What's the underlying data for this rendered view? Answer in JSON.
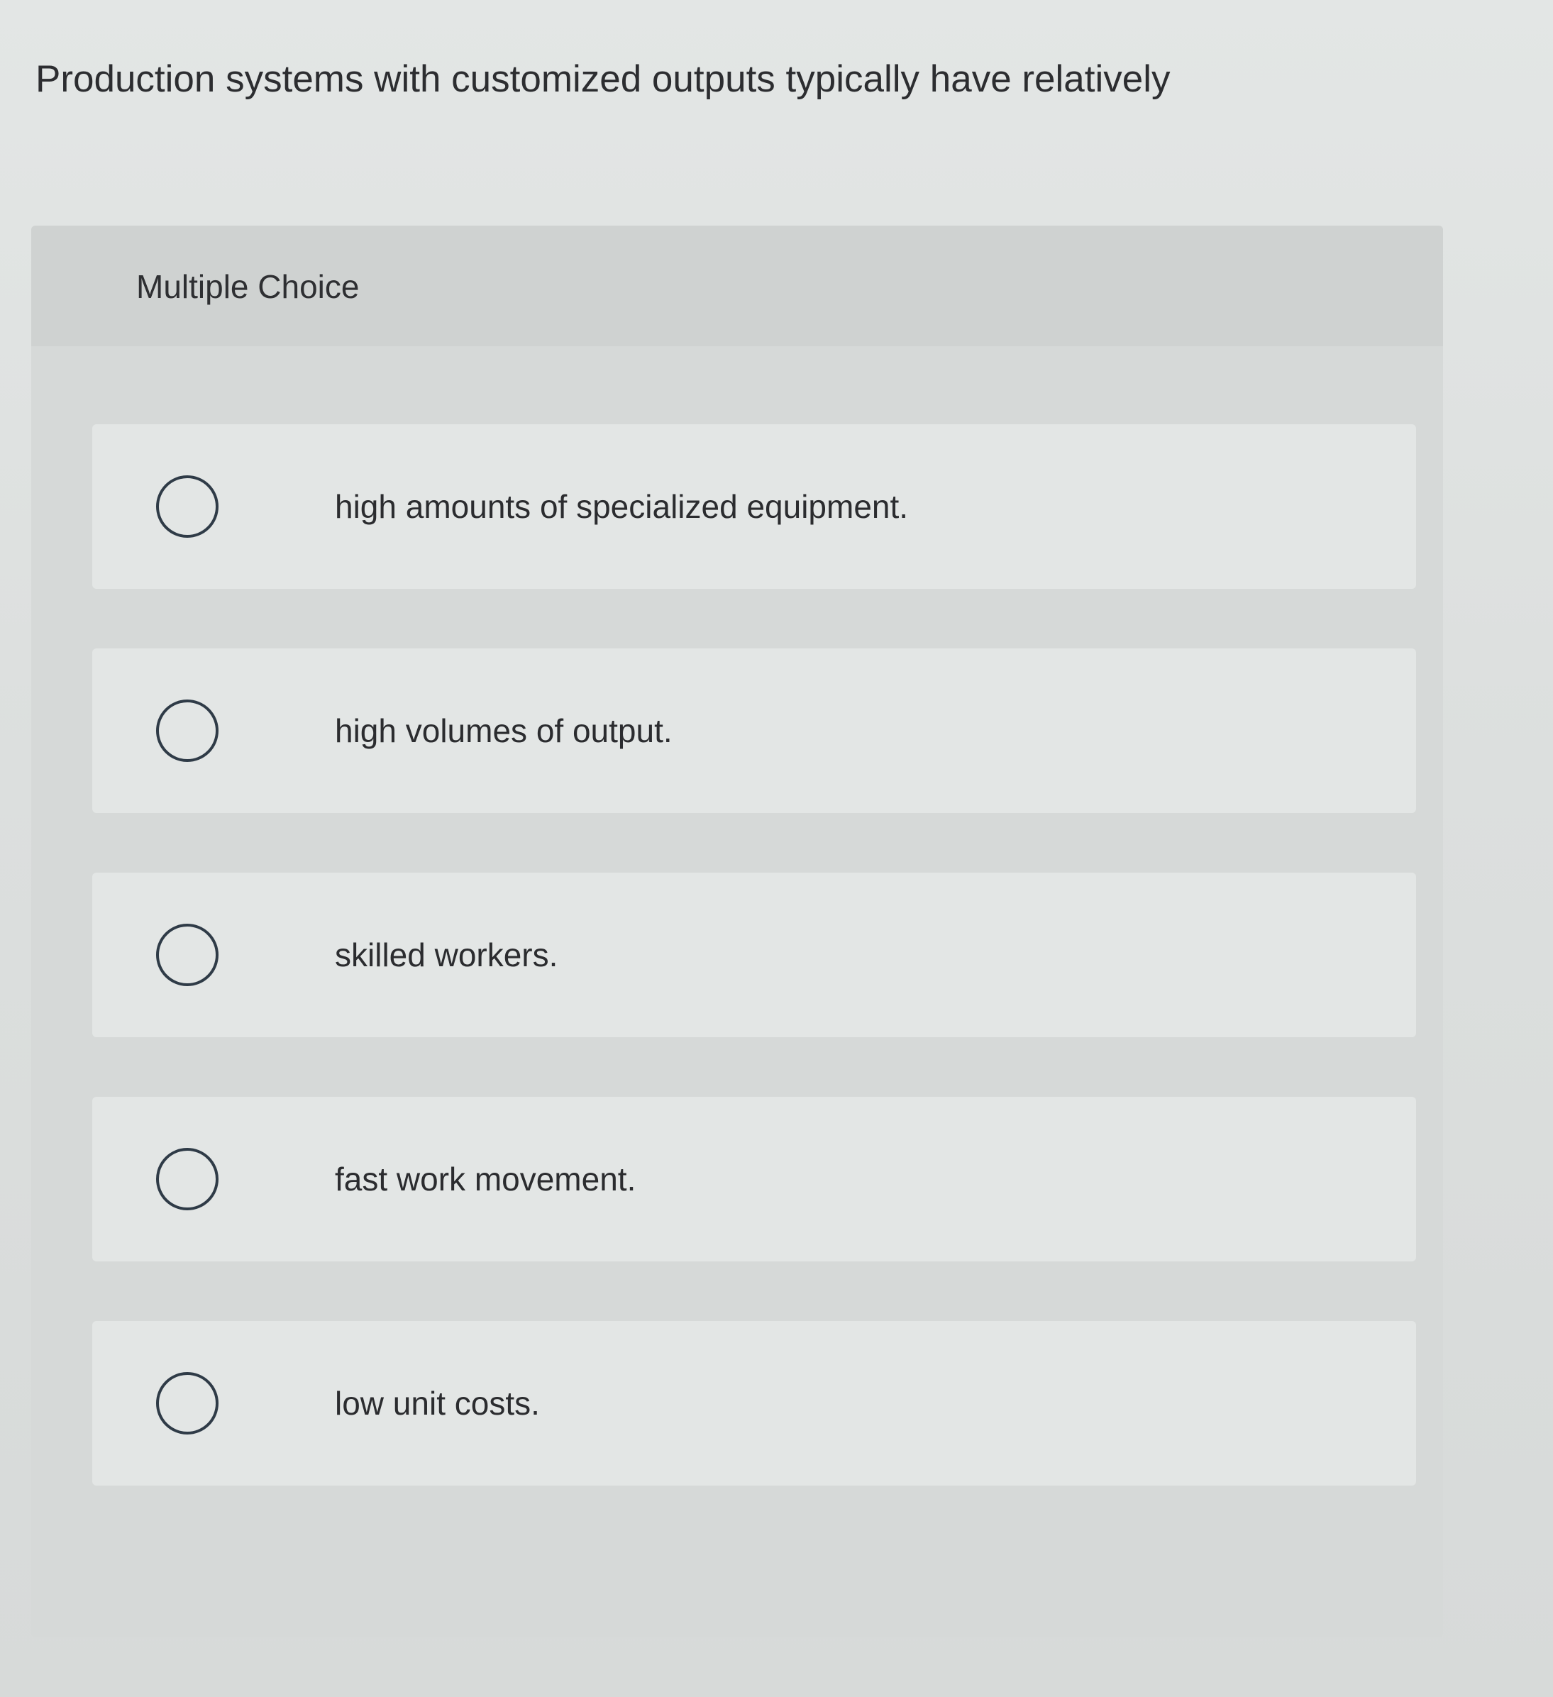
{
  "question": {
    "text": "Production systems with customized outputs typically have relatively"
  },
  "multiple_choice": {
    "title": "Multiple Choice",
    "options": [
      {
        "label": "high amounts of specialized equipment."
      },
      {
        "label": "high volumes of output."
      },
      {
        "label": "skilled workers."
      },
      {
        "label": "fast work movement."
      },
      {
        "label": "low unit costs."
      }
    ]
  },
  "colors": {
    "background": "#dcdfde",
    "panel": "#d6d9d8",
    "option_row": "#e3e6e5",
    "radio_border": "#2f3b47",
    "text": "#2c2d30"
  }
}
